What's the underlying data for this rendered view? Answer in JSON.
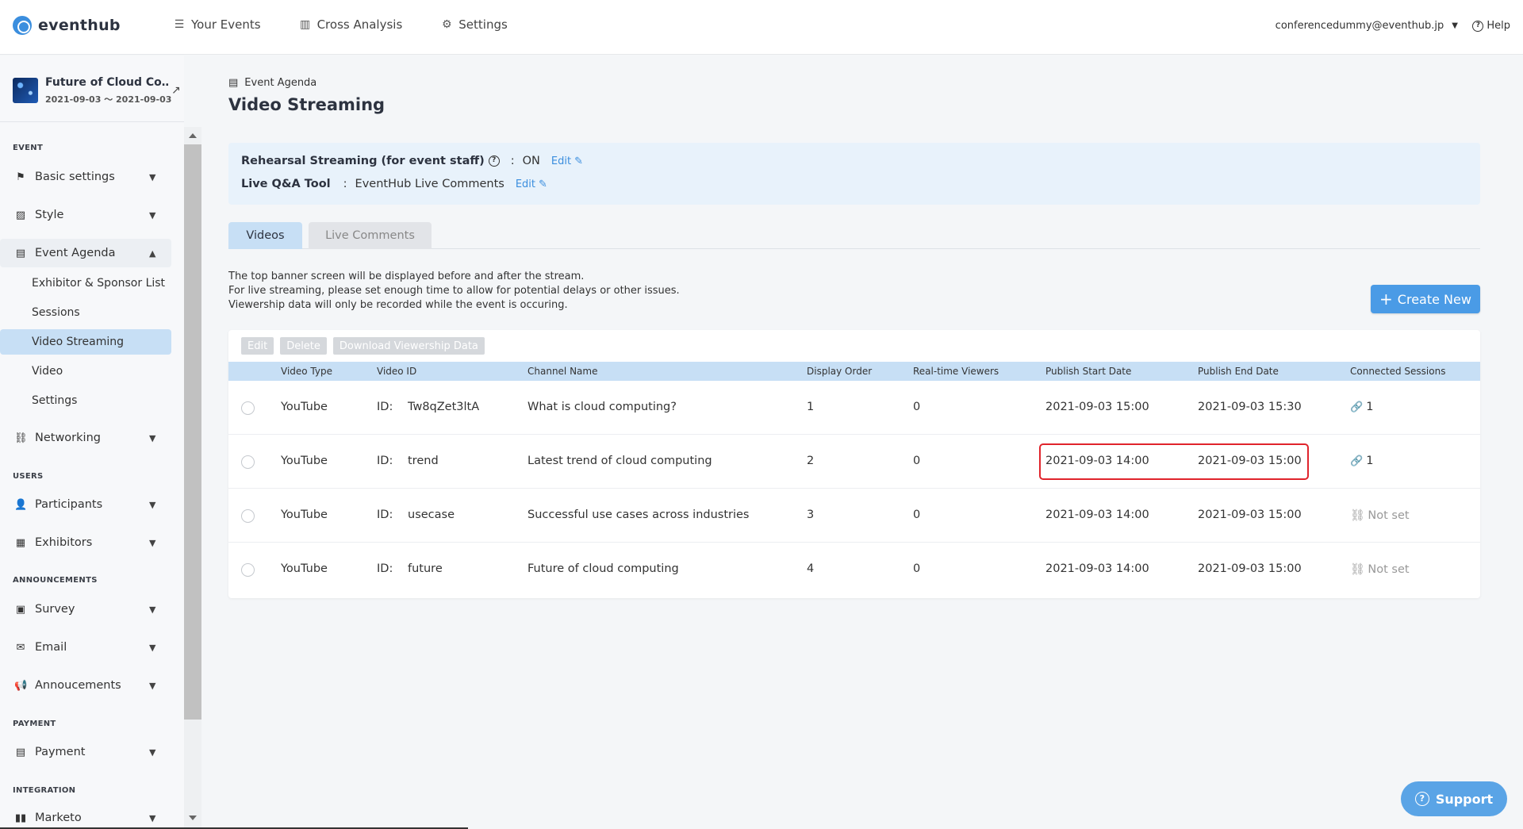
{
  "app": {
    "logo_text": "eventhub",
    "nav": [
      {
        "label": "Your Events",
        "icon": "list-icon"
      },
      {
        "label": "Cross Analysis",
        "icon": "bar-chart-icon"
      },
      {
        "label": "Settings",
        "icon": "gear-icon"
      }
    ],
    "user_email": "conferencedummy@eventhub.jp",
    "help_label": "Help"
  },
  "event": {
    "name": "Future of Cloud Co…",
    "dates": "2021-09-03 ～ 2021-09-03"
  },
  "sidebar": {
    "sections": {
      "event": "EVENT",
      "users": "USERS",
      "announcements": "ANNOUNCEMENTS",
      "payment": "PAYMENT",
      "integration": "INTEGRATION"
    },
    "items": {
      "basic_settings": "Basic settings",
      "style": "Style",
      "event_agenda": "Event Agenda",
      "networking": "Networking",
      "participants": "Participants",
      "exhibitors": "Exhibitors",
      "survey": "Survey",
      "email": "Email",
      "announcements": "Annoucements",
      "payment": "Payment",
      "marketo": "Marketo"
    },
    "agenda_sub": [
      "Exhibitor & Sponsor List",
      "Sessions",
      "Video Streaming",
      "Video",
      "Settings"
    ]
  },
  "page": {
    "breadcrumb": "Event Agenda",
    "title": "Video Streaming",
    "rehearsal_label": "Rehearsal Streaming (for event staff)",
    "rehearsal_value": "ON",
    "qa_label": "Live Q&A Tool",
    "qa_value": "EventHub Live Comments",
    "colon": ":",
    "edit_label": "Edit",
    "tabs": {
      "videos": "Videos",
      "live_comments": "Live Comments"
    },
    "notes": [
      "The top banner screen will be displayed before and after the stream.",
      "For live streaming, please set enough time to allow for potential delays or other issues.",
      "Viewership data will only be recorded while the event is occuring."
    ],
    "create_label": "Create New",
    "actions": {
      "edit": "Edit",
      "delete": "Delete",
      "download": "Download Viewership Data"
    }
  },
  "table": {
    "headers": {
      "video_type": "Video Type",
      "video_id": "Video ID",
      "channel_name": "Channel Name",
      "display_order": "Display Order",
      "viewers": "Real-time Viewers",
      "start": "Publish Start Date",
      "end": "Publish End Date",
      "sessions": "Connected Sessions"
    },
    "id_prefix": "ID:",
    "rows": [
      {
        "type": "YouTube",
        "id": "Tw8qZet3ltA",
        "channel": "What is cloud computing?",
        "order": "1",
        "viewers": "0",
        "start": "2021-09-03 15:00",
        "end": "2021-09-03 15:30",
        "sessions": "1"
      },
      {
        "type": "YouTube",
        "id": "trend",
        "channel": "Latest trend of cloud computing",
        "order": "2",
        "viewers": "0",
        "start": "2021-09-03 14:00",
        "end": "2021-09-03 15:00",
        "sessions": "1"
      },
      {
        "type": "YouTube",
        "id": "usecase",
        "channel": "Successful use cases across industries",
        "order": "3",
        "viewers": "0",
        "start": "2021-09-03 14:00",
        "end": "2021-09-03 15:00",
        "sessions": "Not set"
      },
      {
        "type": "YouTube",
        "id": "future",
        "channel": "Future of cloud computing",
        "order": "4",
        "viewers": "0",
        "start": "2021-09-03 14:00",
        "end": "2021-09-03 15:00",
        "sessions": "Not set"
      }
    ]
  },
  "support_label": "Support",
  "colors": {
    "accent": "#3b8ede",
    "highlight": "#e0242c",
    "active_bg": "#c7dff5"
  }
}
